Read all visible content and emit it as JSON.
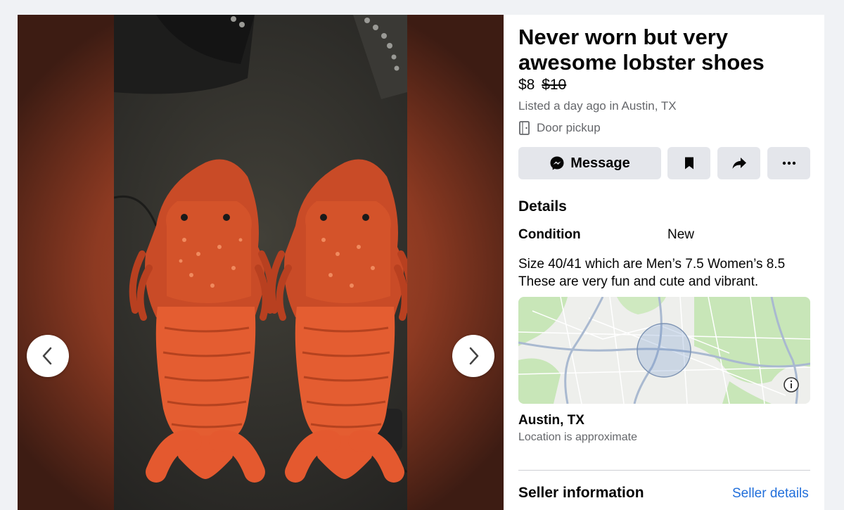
{
  "listing": {
    "title": "Never worn but very awesome lobster shoes",
    "price": "$8",
    "original_price": "$10",
    "listed": "Listed a day ago in Austin, TX",
    "pickup": "Door pickup"
  },
  "actions": {
    "message_label": "Message",
    "save_icon": "bookmark-icon",
    "share_icon": "share-icon",
    "more_icon": "more-icon"
  },
  "details": {
    "heading": "Details",
    "condition_label": "Condition",
    "condition_value": "New",
    "description_line1": "Size 40/41 which are Men’s 7.5 Women’s 8.5",
    "description_line2": "These are very fun and cute and vibrant."
  },
  "location": {
    "city": "Austin, TX",
    "note": "Location is approximate"
  },
  "seller": {
    "heading": "Seller information",
    "link": "Seller details"
  },
  "colors": {
    "button_bg": "#e4e6eb",
    "link_blue": "#216fdb",
    "muted_text": "#65676b",
    "lobster_orange": "#e2572c"
  }
}
